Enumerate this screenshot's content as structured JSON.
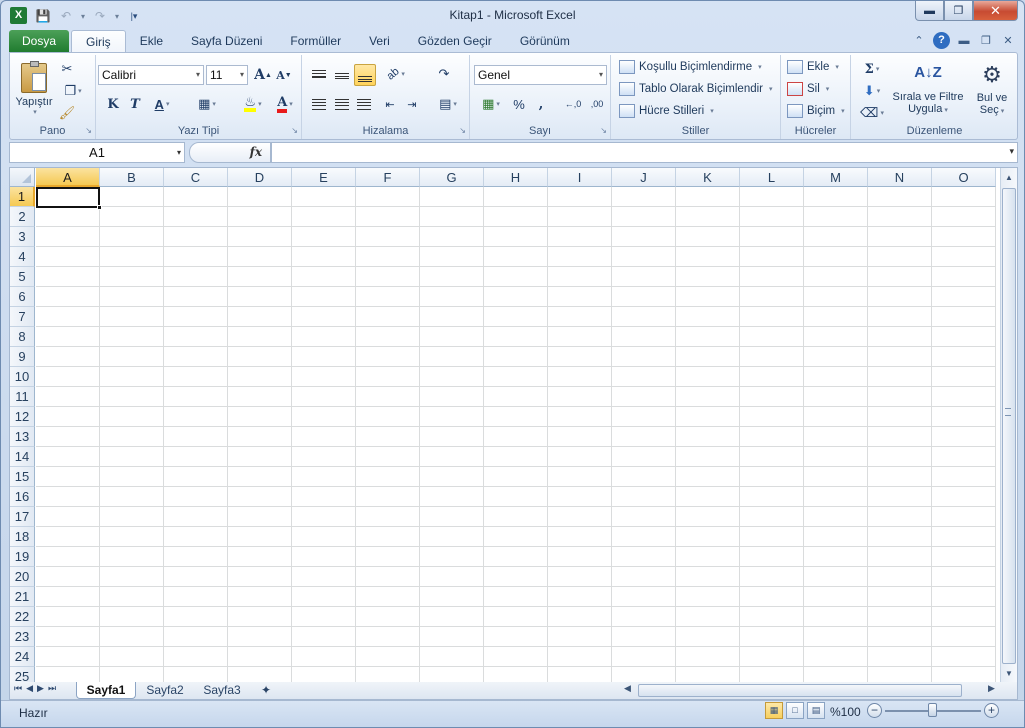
{
  "window": {
    "title": "Kitap1  -  Microsoft Excel"
  },
  "qat": {
    "app_icon": "X"
  },
  "tabs": [
    {
      "label": "Dosya"
    },
    {
      "label": "Giriş"
    },
    {
      "label": "Ekle"
    },
    {
      "label": "Sayfa Düzeni"
    },
    {
      "label": "Formüller"
    },
    {
      "label": "Veri"
    },
    {
      "label": "Gözden Geçir"
    },
    {
      "label": "Görünüm"
    }
  ],
  "ribbon": {
    "pano": {
      "label": "Pano",
      "paste": "Yapıştır"
    },
    "font": {
      "label": "Yazı Tipi",
      "name": "Calibri",
      "size": "11",
      "bold": "K",
      "italic": "T",
      "underline": "A",
      "grow": "A",
      "shrink": "A",
      "color": "A"
    },
    "align": {
      "label": "Hizalama"
    },
    "number": {
      "label": "Sayı",
      "format": "Genel",
      "percent": "%",
      "comma": ",",
      "inc": "←,0",
      "dec": ",00"
    },
    "styles": {
      "label": "Stiller",
      "cond": "Koşullu Biçimlendirme",
      "table": "Tablo Olarak Biçimlendir",
      "cell": "Hücre Stilleri"
    },
    "cells": {
      "label": "Hücreler",
      "insert": "Ekle",
      "delete": "Sil",
      "format": "Biçim"
    },
    "editing": {
      "label": "Düzenleme",
      "sum": "Σ",
      "sort": "Sırala ve Filtre",
      "sort2": "Uygula",
      "find": "Bul ve",
      "find2": "Seç"
    }
  },
  "formula": {
    "cell_ref": "A1",
    "fx": "fx",
    "value": ""
  },
  "grid": {
    "columns": [
      "A",
      "B",
      "C",
      "D",
      "E",
      "F",
      "G",
      "H",
      "I",
      "J",
      "K",
      "L",
      "M",
      "N",
      "O"
    ],
    "rows": [
      "1",
      "2",
      "3",
      "4",
      "5",
      "6",
      "7",
      "8",
      "9",
      "10",
      "11",
      "12",
      "13",
      "14",
      "15",
      "16",
      "17",
      "18",
      "19",
      "20",
      "21",
      "22",
      "23",
      "24",
      "25"
    ],
    "selected_cell": "A1"
  },
  "sheets": [
    {
      "label": "Sayfa1",
      "active": true
    },
    {
      "label": "Sayfa2"
    },
    {
      "label": "Sayfa3"
    }
  ],
  "status": {
    "text": "Hazır",
    "zoom": "%100",
    "zoom_out": "−",
    "zoom_in": "+"
  }
}
